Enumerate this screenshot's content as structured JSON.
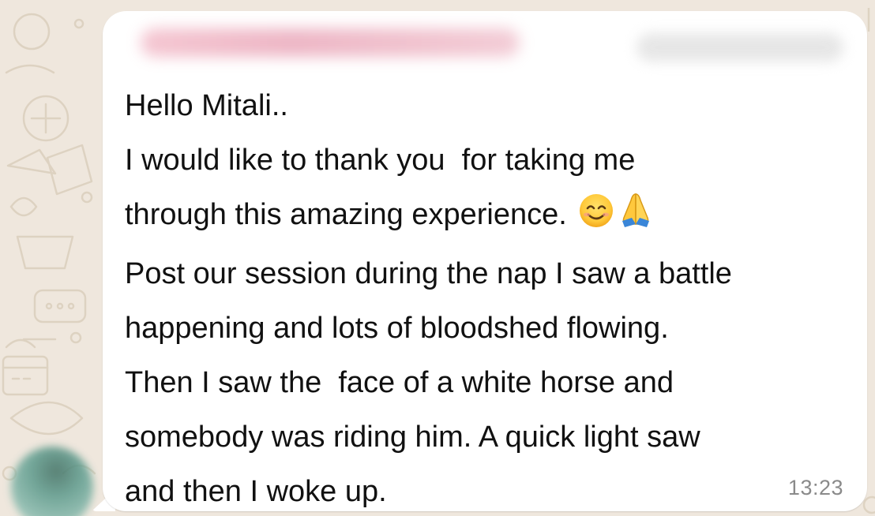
{
  "chat": {
    "background_color": "#efe7dd",
    "bubble_color": "#ffffff",
    "text_color": "#111111",
    "timestamp_color": "#8a8a8a",
    "message": {
      "lines": [
        "Hello Mitali..",
        "I would like to thank you  for taking me",
        "through this amazing experience.",
        "Post our session during the nap I saw a battle",
        "happening and lots of bloodshed flowing.",
        "Then I saw the  face of a white horse and",
        "somebody was riding him. A quick light saw",
        "and then I woke up."
      ],
      "emojis": [
        "smiling-face-icon",
        "folded-hands-icon"
      ],
      "time": "13:23"
    }
  }
}
